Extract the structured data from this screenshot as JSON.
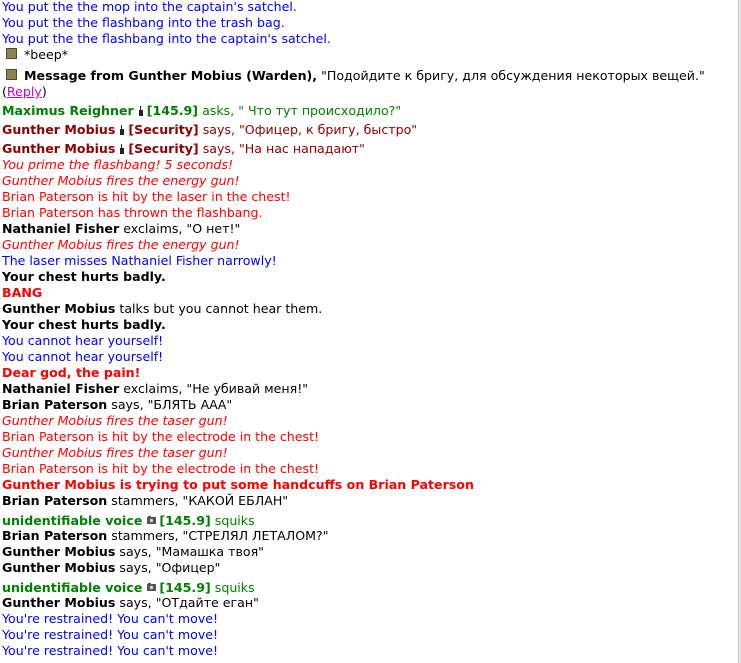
{
  "messages": [
    {
      "text": "You put the the mop into the captain's satchel."
    },
    {
      "text": "You put the the flashbang into the trash bag."
    },
    {
      "text": "You put the the flashbang into the captain's satchel."
    },
    {
      "icon": "pda-icon",
      "text": "*beep*"
    },
    {
      "icon": "pda-icon",
      "speaker": "Message from Gunther Mobius (Warden),",
      "text": "\"Подойдите к бригу, для обсуждения некоторых вещей.\"",
      "reply": "Reply"
    },
    {
      "speaker": "Maximus Reighner",
      "frequency": "[145.9]",
      "text": "asks, \" Что тут происходило?\""
    },
    {
      "speaker": "Gunther Mobius",
      "channel": "[Security]",
      "text": "says, \"Офицер, к бригу, быстро\""
    },
    {
      "speaker": "Gunther Mobius",
      "channel": "[Security]",
      "text": "says, \"На нас нападают\""
    },
    {
      "text": "You prime the flashbang! 5 seconds!"
    },
    {
      "text": "Gunther Mobius fires the energy gun!"
    },
    {
      "text": "Brian Paterson is hit by the laser in the chest!"
    },
    {
      "text": "Brian Paterson has thrown the flashbang."
    },
    {
      "speaker": "Nathaniel Fisher",
      "text": "exclaims, \"О нет!\""
    },
    {
      "text": "Gunther Mobius fires the energy gun!"
    },
    {
      "text": "The laser misses Nathaniel Fisher narrowly!"
    },
    {
      "text": "Your chest hurts badly."
    },
    {
      "text": "BANG"
    },
    {
      "speaker": "Gunther Mobius",
      "text": "talks but you cannot hear them."
    },
    {
      "text": "Your chest hurts badly."
    },
    {
      "text": "You cannot hear yourself!"
    },
    {
      "text": "You cannot hear yourself!"
    },
    {
      "text": "Dear god, the pain!"
    },
    {
      "speaker": "Nathaniel Fisher",
      "text": "exclaims, \"Не убивай меня!\""
    },
    {
      "speaker": "Brian Paterson",
      "text": "says, \"БЛЯТЬ ААА\""
    },
    {
      "text": "Gunther Mobius fires the taser gun!"
    },
    {
      "text": "Brian Paterson is hit by the electrode in the chest!"
    },
    {
      "text": "Gunther Mobius fires the taser gun!"
    },
    {
      "text": "Brian Paterson is hit by the electrode in the chest!"
    },
    {
      "text": "Gunther Mobius is trying to put some handcuffs on Brian Paterson"
    },
    {
      "speaker": "Brian Paterson",
      "text": "stammers, \"КАКОЙ ЕБЛАН\""
    },
    {
      "speaker": "unidentifiable voice",
      "frequency": "[145.9]",
      "text": "squiks"
    },
    {
      "speaker": "Brian Paterson",
      "text": "stammers, \"СТРЕЛЯЛ ЛЕТАЛОМ?\""
    },
    {
      "speaker": "Gunther Mobius",
      "text": "says, \"Мамашка твоя\""
    },
    {
      "speaker": "Gunther Mobius",
      "text": "says, \"Офицер\""
    },
    {
      "speaker": "unidentifiable voice",
      "frequency": "[145.9]",
      "text": "squiks"
    },
    {
      "speaker": "Gunther Mobius",
      "text": "says, \"ОТдайте еган\""
    },
    {
      "text": "You're restrained! You can't move!"
    },
    {
      "text": "You're restrained! You can't move!"
    },
    {
      "text": "You're restrained! You can't move!"
    }
  ],
  "colors": {
    "blue": "#0000ff",
    "red": "#ff0000",
    "radio_green": "#008000",
    "security_red": "#8b0000",
    "reply_link": "#cc00cc"
  }
}
